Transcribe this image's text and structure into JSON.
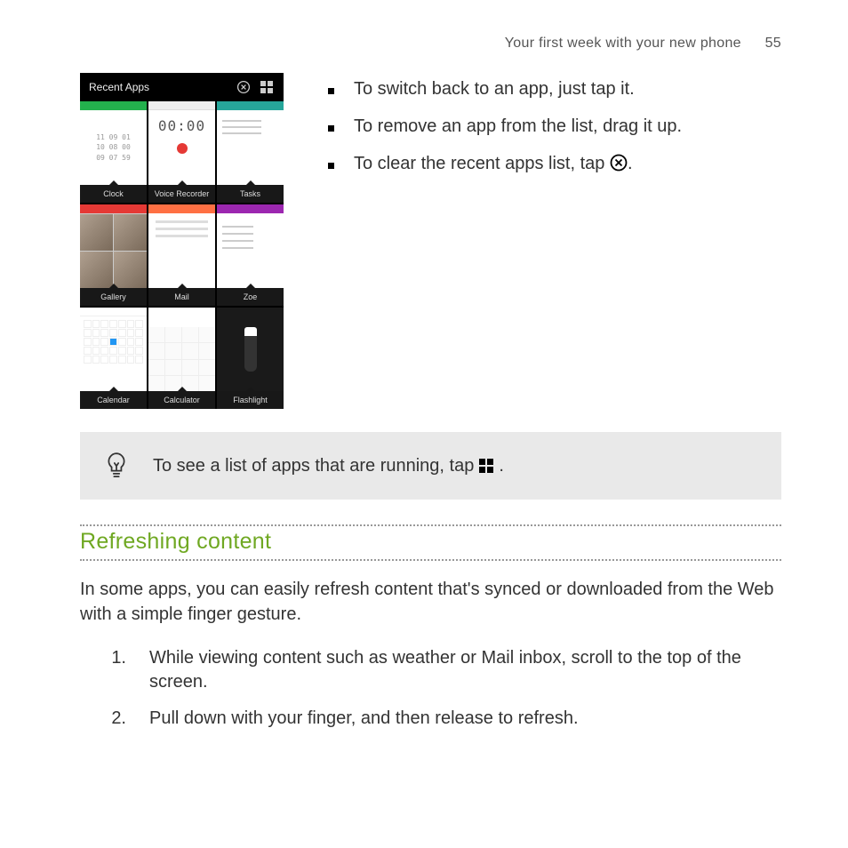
{
  "header": {
    "chapter": "Your first week with your new phone",
    "page": "55"
  },
  "screenshot": {
    "title": "Recent Apps",
    "apps": {
      "clock": "Clock",
      "voice_recorder": "Voice Recorder",
      "tasks": "Tasks",
      "gallery": "Gallery",
      "mail": "Mail",
      "zoe": "Zoe",
      "calendar": "Calendar",
      "calculator": "Calculator",
      "flashlight": "Flashlight"
    },
    "recorder_time": "00:00",
    "clock_rows": [
      "11  09  01",
      "10  08  00",
      "09  07  59"
    ]
  },
  "bullets": {
    "b1": "To switch back to an app, just tap it.",
    "b2": "To remove an app from the list, drag it up.",
    "b3_pre": "To clear the recent apps list, tap ",
    "b3_post": "."
  },
  "tip": {
    "pre": "To see a list of apps that are running, tap ",
    "post": "."
  },
  "section": {
    "heading": "Refreshing content",
    "intro": "In some apps, you can easily refresh content that's synced or downloaded from the Web with a simple finger gesture."
  },
  "steps": {
    "n1": "1.",
    "s1": "While viewing content such as weather or Mail inbox, scroll to the top of the screen.",
    "n2": "2.",
    "s2": "Pull down with your finger, and then release to refresh."
  }
}
